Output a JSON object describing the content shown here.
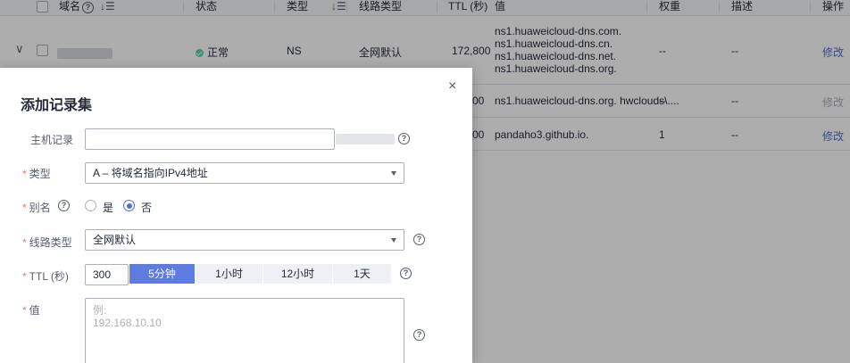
{
  "table": {
    "headers": {
      "name": "域名",
      "status": "状态",
      "type": "类型",
      "line_type": "线路类型",
      "ttl": "TTL (秒)",
      "value": "值",
      "weight": "权重",
      "description": "描述",
      "action": "操作"
    },
    "rows": [
      {
        "status": "正常",
        "type": "NS",
        "line": "全网默认",
        "ttl": "172,800",
        "values": [
          "ns1.huaweicloud-dns.com.",
          "ns1.huaweicloud-dns.cn.",
          "ns1.huaweicloud-dns.net.",
          "ns1.huaweicloud-dns.org."
        ],
        "weight": "--",
        "description": "--",
        "action": "修改"
      },
      {
        "ttl": "00",
        "value": "ns1.huaweicloud-dns.org. hwclouds\\....",
        "weight": "--",
        "description": "--",
        "action": "修改"
      },
      {
        "ttl": "00",
        "value": "pandaho3.github.io.",
        "weight": "1",
        "description": "--",
        "action": "修改"
      }
    ]
  },
  "dialog": {
    "title": "添加记录集",
    "close": "×",
    "host_record": {
      "label": "主机记录",
      "value": ""
    },
    "type": {
      "label": "类型",
      "value": "A – 将域名指向IPv4地址"
    },
    "alias": {
      "label": "别名",
      "yes": "是",
      "no": "否",
      "selected": "否"
    },
    "line_type": {
      "label": "线路类型",
      "value": "全网默认"
    },
    "ttl": {
      "label": "TTL (秒)",
      "value": "300",
      "options": [
        "5分钟",
        "1小时",
        "12小时",
        "1天"
      ],
      "selected": "5分钟"
    },
    "value": {
      "label": "值",
      "placeholder": "例:\n192.168.10.10"
    },
    "required_mark": "*",
    "help_glyph": "?"
  },
  "colors": {
    "accent": "#5e7ce0",
    "link": "#526ecc",
    "required": "#f66f6a",
    "status_ok": "#50d4ab"
  }
}
